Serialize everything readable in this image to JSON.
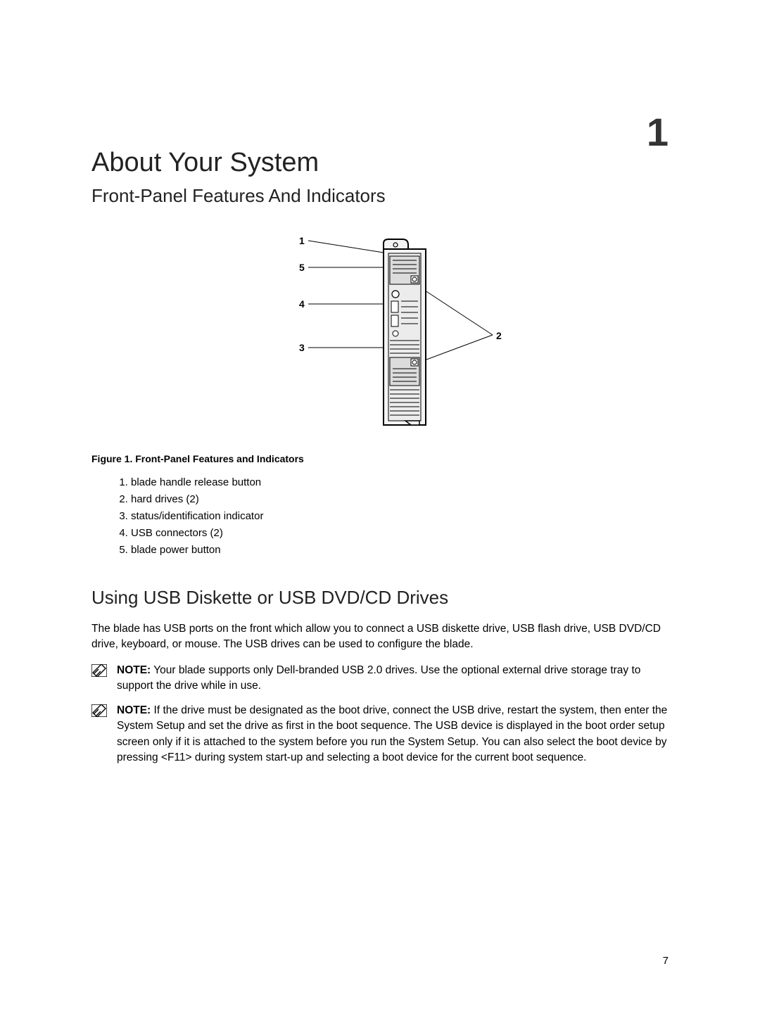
{
  "chapter_number": "1",
  "title": "About Your System",
  "section1_title": "Front-Panel Features And Indicators",
  "figure_caption": "Figure 1. Front-Panel Features and Indicators",
  "callouts": [
    "blade handle release button",
    "hard drives (2)",
    "status/identification indicator",
    "USB connectors (2)",
    "blade power button"
  ],
  "diagram_labels": {
    "n1": "1",
    "n2": "2",
    "n3": "3",
    "n4": "4",
    "n5": "5"
  },
  "section2_title": "Using USB Diskette or USB DVD/CD Drives",
  "usb_paragraph": "The blade has USB ports on the front which allow you to connect a USB diskette drive, USB flash drive, USB DVD/CD drive, keyboard, or mouse. The USB drives can be used to configure the blade.",
  "note_label": "NOTE:",
  "note1": " Your blade supports only Dell-branded USB 2.0 drives. Use the optional external drive storage tray to support the drive while in use.",
  "note2": " If the drive must be designated as the boot drive, connect the USB drive, restart the system, then enter the System Setup and set the drive as first in the boot sequence. The USB device is displayed in the boot order setup screen only if it is attached to the system before you run the System Setup. You can also select the boot device by pressing <F11> during system start-up and selecting a boot device for the current boot sequence.",
  "page_number": "7"
}
